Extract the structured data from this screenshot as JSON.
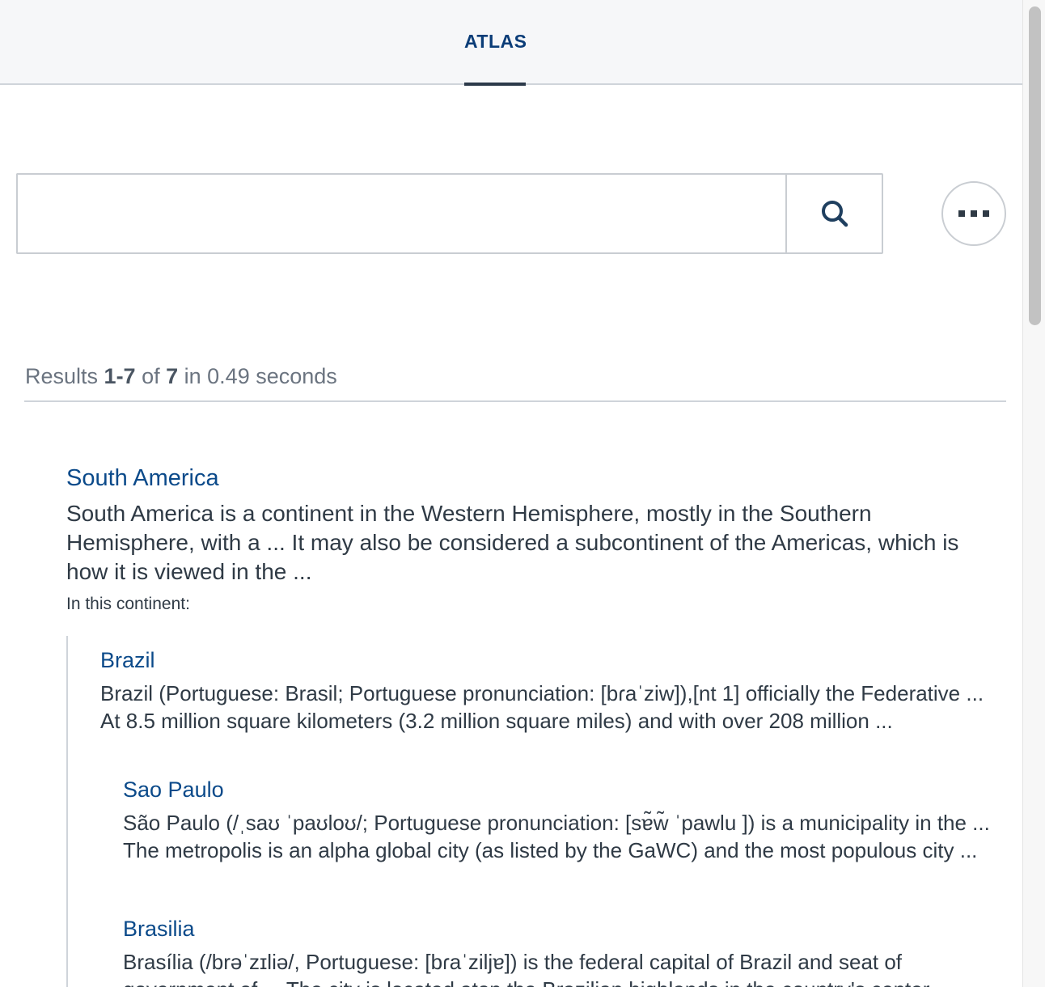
{
  "header": {
    "tab_label": "ATLAS"
  },
  "search": {
    "value": "",
    "placeholder": "",
    "button_icon": "search-icon",
    "more_icon": "more-horizontal-icon"
  },
  "results_summary": {
    "prefix": "Results ",
    "range": "1-7",
    "of": " of ",
    "total": "7",
    "suffix": " in 0.49 seconds"
  },
  "results": [
    {
      "title": "South America",
      "snippet": "South America is a continent in the Western Hemisphere, mostly in the Southern Hemisphere, with a ... It may also be considered a subcontinent of the Americas, which is how it is viewed in the ...",
      "sub_label": "In this continent:",
      "children": [
        {
          "title": "Brazil",
          "snippet": "Brazil (Portuguese: Brasil; Portuguese pronunciation: [bɾaˈziw]),[nt 1] officially the Federative ... At 8.5 million square kilometers (3.2 million square miles) and with over 208 million ...",
          "children": [
            {
              "title": "Sao Paulo",
              "snippet": "São Paulo (/ˌsaʊ ˈpaʊloʊ/; Portuguese pronunciation: [sɐ̃w̃ ˈpawlu ]) is a municipality in the ... The metropolis is an alpha global city (as listed by the GaWC) and the most populous city ..."
            },
            {
              "title": "Brasilia",
              "snippet": "Brasília (/brəˈzɪliə/, Portuguese: [bɾaˈziljɐ]) is the federal capital of Brazil and seat of government of ... The city is located atop the Brazilian highlands in the country's center-"
            }
          ]
        }
      ]
    }
  ]
}
